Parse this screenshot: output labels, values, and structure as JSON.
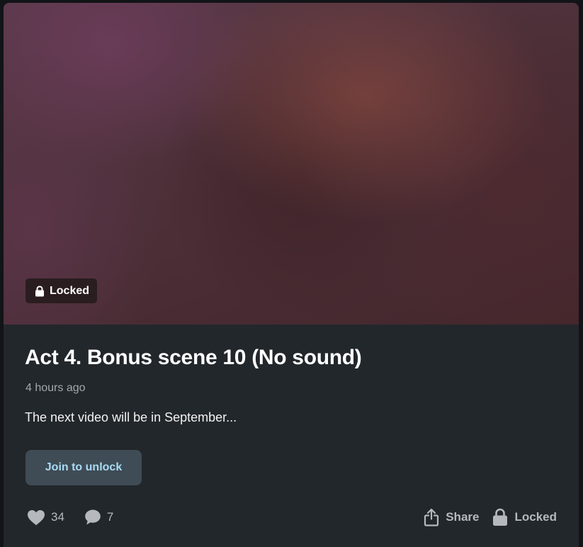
{
  "post": {
    "badge_label": "Locked",
    "title": "Act 4. Bonus scene 10 (No sound)",
    "time_ago": "4 hours ago",
    "description": "The next video will be in September...",
    "join_button_label": "Join to unlock"
  },
  "footer": {
    "likes_count": "34",
    "comments_count": "7",
    "share_label": "Share",
    "locked_label": "Locked"
  },
  "icons": {
    "badge": "lock-icon",
    "likes": "heart-icon",
    "comments": "comment-bubble-icon",
    "share": "share-icon",
    "locked": "lock-icon"
  },
  "colors": {
    "card_background": "#22272c",
    "join_button_background": "#3f4c55",
    "join_button_text": "#a9dbf5"
  }
}
